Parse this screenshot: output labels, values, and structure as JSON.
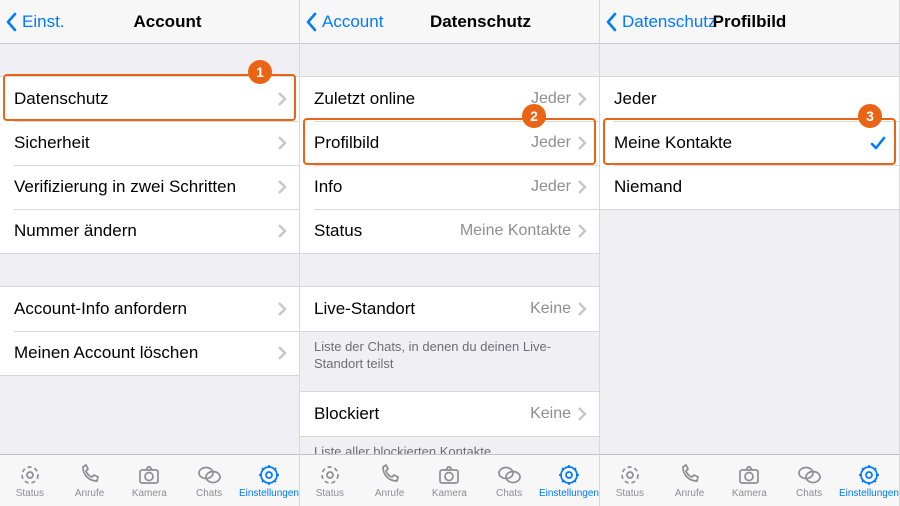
{
  "screen1": {
    "back": "Einst.",
    "title": "Account",
    "group1": [
      {
        "label": "Datenschutz"
      },
      {
        "label": "Sicherheit"
      },
      {
        "label": "Verifizierung in zwei Schritten"
      },
      {
        "label": "Nummer ändern"
      }
    ],
    "group2": [
      {
        "label": "Account-Info anfordern"
      },
      {
        "label": "Meinen Account löschen"
      }
    ],
    "badge": "1"
  },
  "screen2": {
    "back": "Account",
    "title": "Datenschutz",
    "group1": [
      {
        "label": "Zuletzt online",
        "value": "Jeder"
      },
      {
        "label": "Profilbild",
        "value": "Jeder"
      },
      {
        "label": "Info",
        "value": "Jeder"
      },
      {
        "label": "Status",
        "value": "Meine Kontakte"
      }
    ],
    "group2": [
      {
        "label": "Live-Standort",
        "value": "Keine"
      }
    ],
    "note1": "Liste der Chats, in denen du deinen Live-Standort teilst",
    "group3": [
      {
        "label": "Blockiert",
        "value": "Keine"
      }
    ],
    "note2": "Liste aller blockierten Kontakte",
    "badge": "2"
  },
  "screen3": {
    "back": "Datenschutz",
    "title": "Profilbild",
    "options": [
      {
        "label": "Jeder",
        "selected": false
      },
      {
        "label": "Meine Kontakte",
        "selected": true
      },
      {
        "label": "Niemand",
        "selected": false
      }
    ],
    "badge": "3"
  },
  "tabs": [
    {
      "label": "Status"
    },
    {
      "label": "Anrufe"
    },
    {
      "label": "Kamera"
    },
    {
      "label": "Chats"
    },
    {
      "label": "Einstellungen"
    }
  ]
}
